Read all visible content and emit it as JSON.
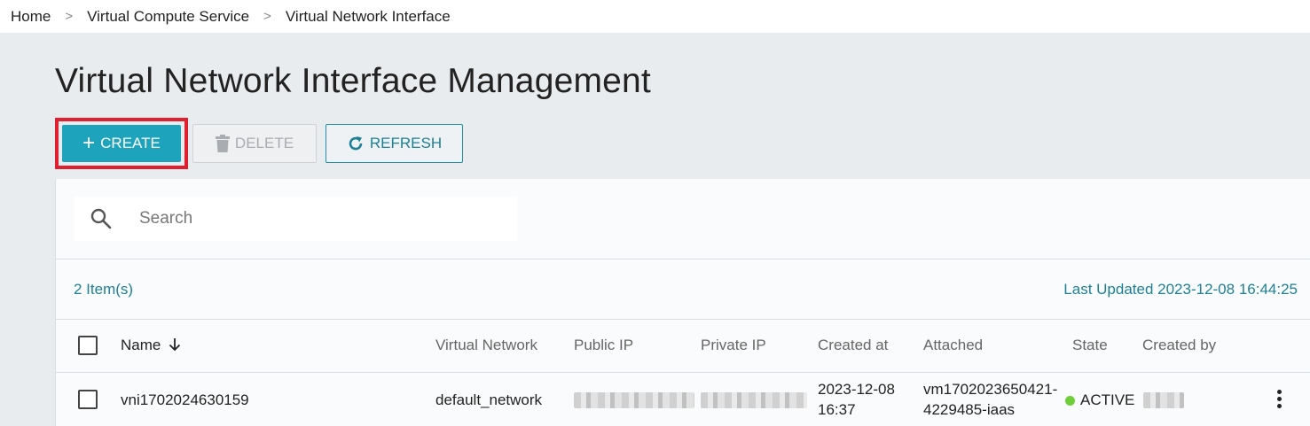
{
  "breadcrumb": {
    "home": "Home",
    "separator": ">",
    "service": "Virtual Compute Service",
    "current": "Virtual Network Interface"
  },
  "page": {
    "title": "Virtual Network Interface Management"
  },
  "toolbar": {
    "create_label": "CREATE",
    "delete_label": "DELETE",
    "refresh_label": "REFRESH",
    "create_icon": "plus-icon",
    "delete_icon": "trash-icon",
    "refresh_icon": "refresh-icon",
    "highlight_color": "#e0202e",
    "accent_color": "#1ea3bd"
  },
  "search": {
    "placeholder": "Search",
    "value": ""
  },
  "summary": {
    "item_count": "2 Item(s)",
    "last_updated": "Last Updated 2023-12-08 16:44:25"
  },
  "table": {
    "columns": {
      "name": "Name",
      "virtual_network": "Virtual Network",
      "public_ip": "Public IP",
      "private_ip": "Private IP",
      "created_at": "Created at",
      "attached": "Attached",
      "state": "State",
      "created_by": "Created by"
    },
    "sort_icon": "arrow-down-icon",
    "rows": [
      {
        "name": "vni1702024630159",
        "virtual_network": "default_network",
        "created_at_line1": "2023-12-08",
        "created_at_line2": "16:37",
        "attached_line1": "vm1702023650421-",
        "attached_line2": "4229485-iaas",
        "state": "ACTIVE",
        "state_color": "#6fcf3b"
      }
    ]
  }
}
